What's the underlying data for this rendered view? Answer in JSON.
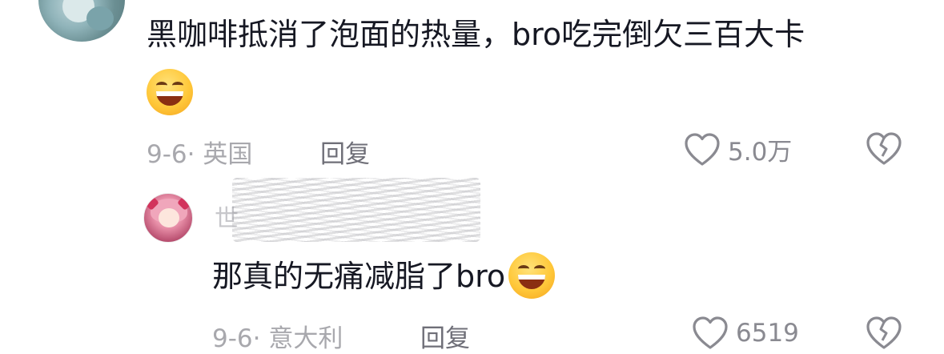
{
  "comments": [
    {
      "text": "黑咖啡抵消了泡面的热量，bro吃完倒欠三百大卡",
      "date": "9-6",
      "separator": "·",
      "location": "英国",
      "reply_label": "回复",
      "likes": "5.0万",
      "emoji": "grinning-face"
    },
    {
      "username": "世",
      "text": "那真的无痛减脂了bro",
      "date": "9-6",
      "separator": "·",
      "location": "意大利",
      "reply_label": "回复",
      "likes": "6519",
      "emoji": "grinning-face"
    }
  ],
  "icons": {
    "like": "heart-outline-icon",
    "dislike": "broken-heart-outline-icon"
  },
  "colors": {
    "text": "#161823",
    "meta": "#a8a8ad",
    "reply": "#6f6f78",
    "icon": "#8a8a91"
  }
}
